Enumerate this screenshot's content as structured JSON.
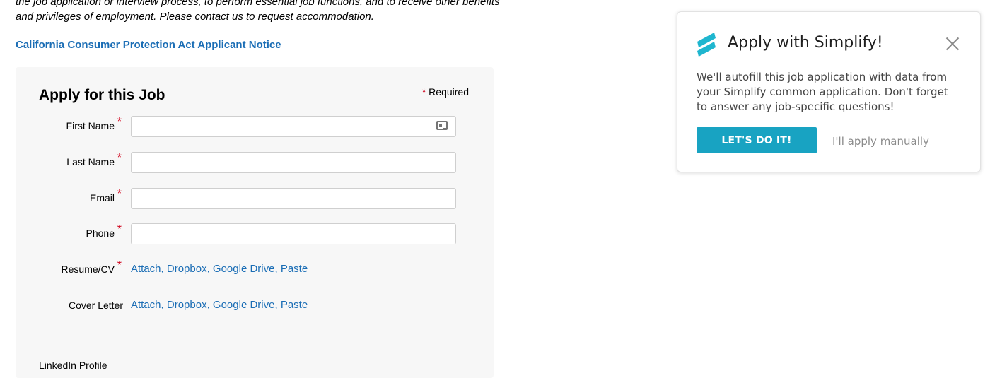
{
  "intro": {
    "line1": "the job application or interview process, to perform essential job functions, and to receive other benefits",
    "line2": "and privileges of employment. Please contact us to request accommodation."
  },
  "ccpa_link": "California Consumer Protection Act Applicant Notice",
  "form": {
    "title": "Apply for this Job",
    "required_asterisk": "*",
    "required_label": "Required",
    "fields": {
      "first_name": {
        "label": "First Name",
        "value": "",
        "required": "*"
      },
      "last_name": {
        "label": "Last Name",
        "value": "",
        "required": "*"
      },
      "email": {
        "label": "Email",
        "value": "",
        "required": "*"
      },
      "phone": {
        "label": "Phone",
        "value": "",
        "required": "*"
      }
    },
    "resume": {
      "label": "Resume/CV",
      "required": "*",
      "options": [
        "Attach",
        "Dropbox",
        "Google Drive",
        "Paste"
      ]
    },
    "cover_letter": {
      "label": "Cover Letter",
      "options": [
        "Attach",
        "Dropbox",
        "Google Drive",
        "Paste"
      ]
    },
    "linkedin_label": "LinkedIn Profile"
  },
  "popup": {
    "title": "Apply with Simplify!",
    "body_line1": "We'll autofill this job application with data from",
    "body_line2": "your Simplify common application. Don't forget",
    "body_line3": "to answer any job-specific questions!",
    "cta_label": "LET'S DO IT!",
    "manual_label": "I'll apply manually",
    "brand_color": "#18a3c2",
    "close_icon": "close-icon"
  },
  "colors": {
    "link": "#1a6db5",
    "required": "#d0021b",
    "form_bg": "#f7f7f7"
  }
}
